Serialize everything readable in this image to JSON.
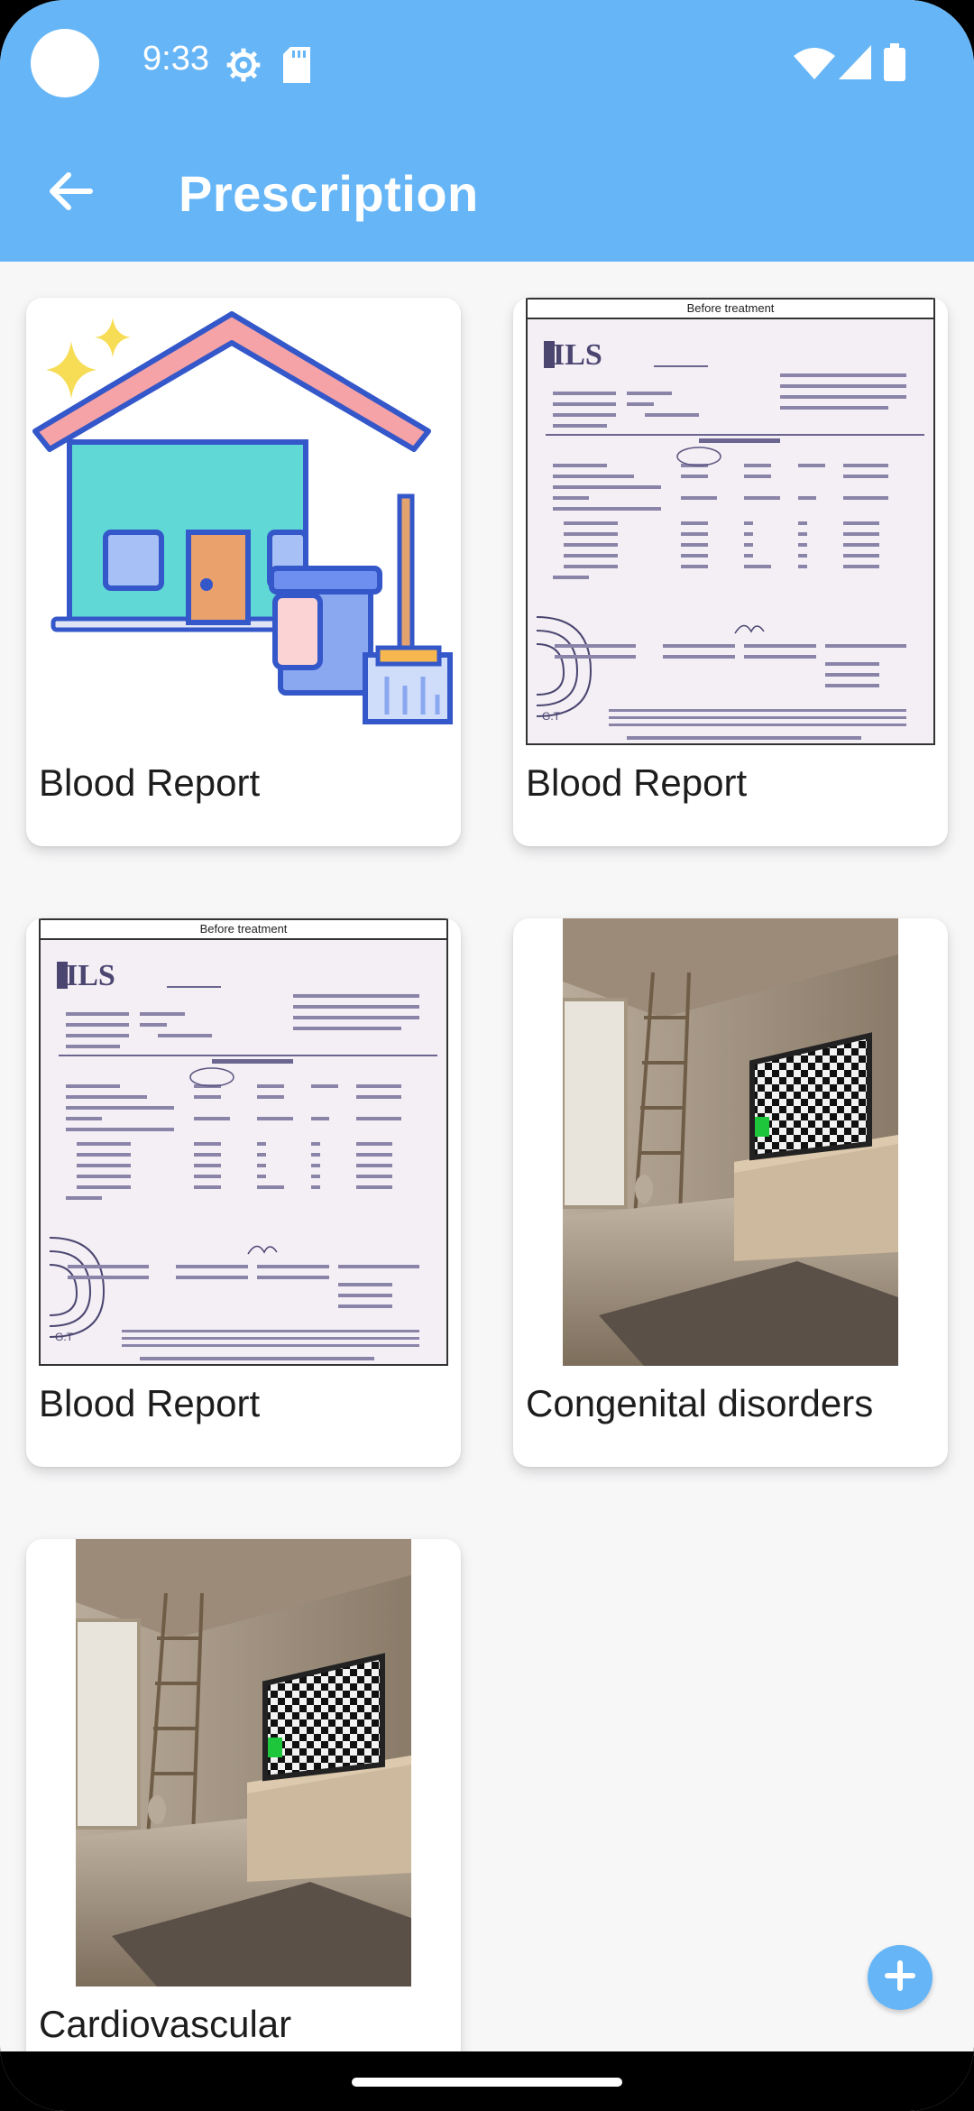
{
  "status_bar": {
    "time": "9:33",
    "icons": [
      "gear-icon",
      "sd-card-icon",
      "wifi-icon",
      "signal-icon",
      "battery-icon"
    ]
  },
  "app_bar": {
    "title": "Prescription",
    "back_icon": "arrow-left-icon",
    "background": "#66b6f7"
  },
  "cards": [
    {
      "label": "Blood Report",
      "image": "house-cleaning-illustration"
    },
    {
      "label": "Blood Report",
      "image": "lab-report-scan",
      "caption": "Before treatment"
    },
    {
      "label": "Blood Report",
      "image": "lab-report-scan",
      "caption": "Before treatment"
    },
    {
      "label": "Congenital disorders",
      "image": "room-with-tv"
    },
    {
      "label": "Cardiovascular",
      "image": "room-with-tv"
    }
  ],
  "fab": {
    "icon": "plus-icon",
    "color": "#66b6f7"
  }
}
